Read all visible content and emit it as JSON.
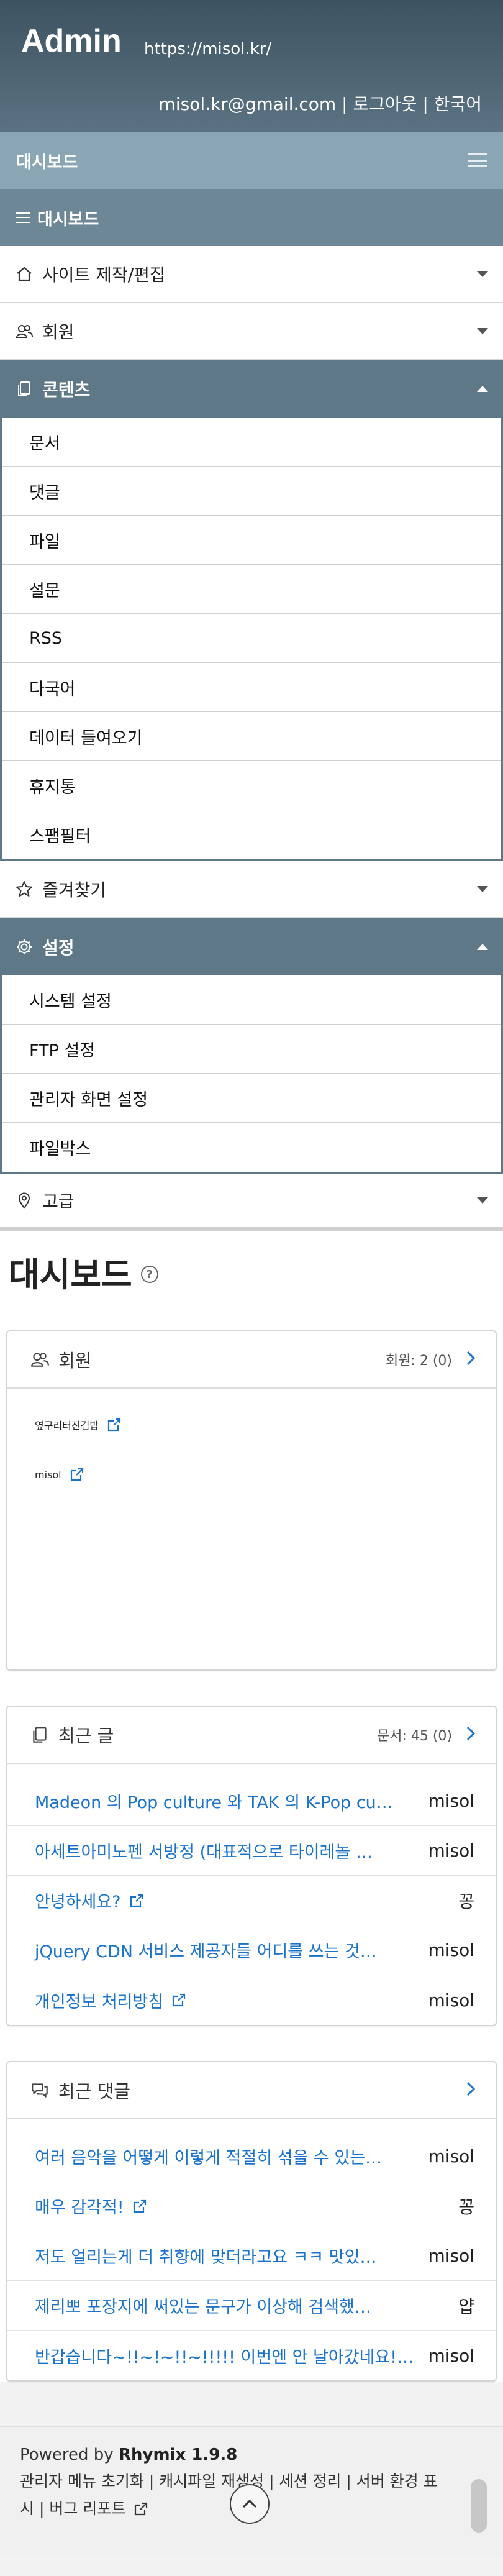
{
  "header": {
    "brand": "Admin",
    "site_url": "https://misol.kr/",
    "email": "misol.kr@gmail.com",
    "sep1": " | ",
    "logout": "로그아웃",
    "sep2": " | ",
    "language": "한국어"
  },
  "dashboard_bar": {
    "label": "대시보드",
    "sub_label": "대시보드"
  },
  "menu": {
    "site_build": "사이트 제작/편집",
    "members": "회원",
    "contents": "콘텐츠",
    "contents_items": [
      "문서",
      "댓글",
      "파일",
      "설문",
      "RSS",
      "다국어",
      "데이터 들여오기",
      "휴지통",
      "스팸필터"
    ],
    "favorites": "즐겨찾기",
    "settings": "설정",
    "settings_items": [
      "시스템 설정",
      "FTP 설정",
      "관리자 화면 설정",
      "파일박스"
    ],
    "advanced": "고급"
  },
  "page": {
    "title": "대시보드"
  },
  "members_card": {
    "title": "회원",
    "count": "회원: 2 (0)",
    "items": [
      "옆구리터진김밥",
      "misol"
    ]
  },
  "recent_docs": {
    "title": "최근 글",
    "count": "문서: 45 (0)",
    "items": [
      {
        "title": "Madeon 의 Pop culture 와 TAK 의 K-Pop cu…",
        "author": "misol"
      },
      {
        "title": "아세트아미노펜 서방정 (대표적으로 타이레놀 …",
        "author": "misol"
      },
      {
        "title": "안녕하세요?",
        "author": "꽁"
      },
      {
        "title": "jQuery CDN 서비스 제공자들 어디를 쓰는 것…",
        "author": "misol"
      },
      {
        "title": "개인정보 처리방침",
        "author": "misol"
      }
    ]
  },
  "recent_comments": {
    "title": "최근 댓글",
    "items": [
      {
        "title": "여러 음악을 어떻게 이렇게 적절히 섞을 수 있는…",
        "author": "misol"
      },
      {
        "title": "매우 감각적!",
        "author": "꽁"
      },
      {
        "title": "저도 얼리는게 더 취향에 맞더라고요 ㅋㅋ 맛있…",
        "author": "misol"
      },
      {
        "title": "제리뽀 포장지에 써있는 문구가 이상해 검색했…",
        "author": "얍"
      },
      {
        "title": "반갑습니다~!!~!~!!~!!!!! 이번엔 안 날아갔네요!…",
        "author": "misol"
      }
    ]
  },
  "footer": {
    "powered_prefix": "Powered by ",
    "powered_name": "Rhymix 1.9.8",
    "links_line1": "관리자 메뉴 초기화 | 캐시파일 재생성 | 세션 정리 | 서버 환경 표",
    "links_line2": "시 | 버그 리포트"
  },
  "colors": {
    "header_top": "#3e5361",
    "menu_open": "#5e7888",
    "dash_bar": "#8aa5b3",
    "link": "#1a73c8"
  }
}
